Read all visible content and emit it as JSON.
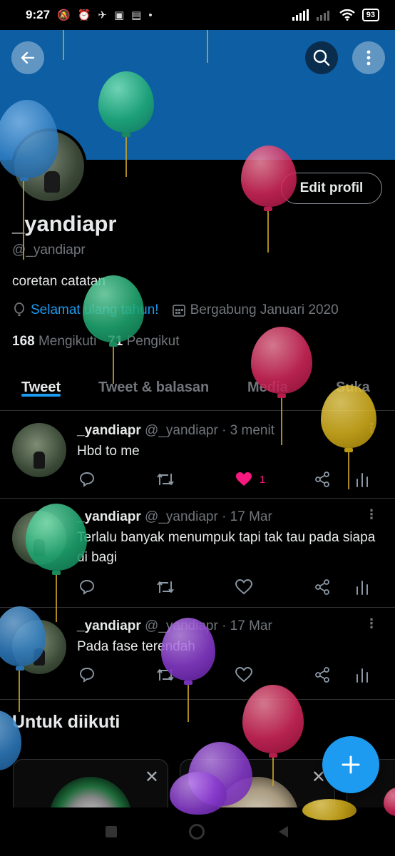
{
  "status_bar": {
    "time": "9:27",
    "battery": "93"
  },
  "profile": {
    "name": "_yandiapr",
    "handle": "@_yandiapr",
    "bio": "coretan catatan",
    "birthday_text": "Selamat ulang tahun!",
    "joined_text": "Bergabung Januari 2020",
    "following_count": "168",
    "following_label": "Mengikuti",
    "followers_count": "71",
    "followers_label": "Pengikut",
    "edit_button": "Edit profil"
  },
  "tabs": [
    {
      "label": "Tweet",
      "active": true
    },
    {
      "label": "Tweet & balasan",
      "active": false
    },
    {
      "label": "Media",
      "active": false
    },
    {
      "label": "Suka",
      "active": false
    }
  ],
  "tweets": [
    {
      "name": "_yandiapr",
      "handle": "@_yandiapr",
      "time": "· 3 menit",
      "text": "Hbd to me",
      "likes": "1",
      "liked": true
    },
    {
      "name": "_yandiapr",
      "handle": "@_yandiapr",
      "time": "· 17 Mar",
      "text": "Terlalu banyak menumpuk tapi tak tau pada siapa di bagi",
      "likes": "",
      "liked": false
    },
    {
      "name": "_yandiapr",
      "handle": "@_yandiapr",
      "time": "· 17 Mar",
      "text": "Pada fase terendah",
      "likes": "",
      "liked": false
    }
  ],
  "suggestions": {
    "title": "Untuk diikuti"
  },
  "colors": {
    "accent": "#1d9bf0",
    "banner": "#0d5ea3",
    "like": "#f91880",
    "background": "#000000"
  },
  "icons": [
    "back-arrow-icon",
    "search-icon",
    "more-vert-icon",
    "balloon-icon",
    "calendar-icon",
    "reply-icon",
    "retweet-icon",
    "heart-icon",
    "share-icon",
    "analytics-icon",
    "plus-icon",
    "close-icon"
  ]
}
